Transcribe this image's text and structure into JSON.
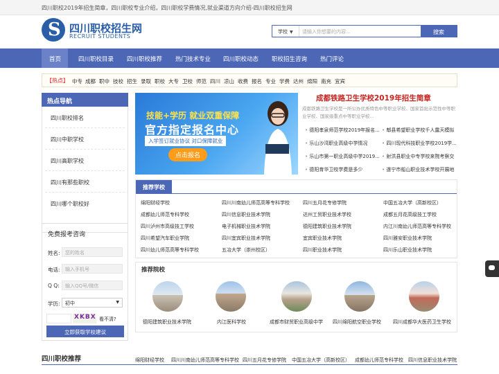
{
  "topbar": {
    "text": "四川职校2019年招生简章，四川职校专业介绍，四川职校学费情况,就业渠道方向介绍-四川职校招生网"
  },
  "logo": {
    "cn": "四川职校招生网",
    "en": "RECRUIT STUDENTS"
  },
  "search": {
    "select": "学校",
    "placeholder": "请输入你想要的内容...",
    "button": "搜索"
  },
  "nav": [
    "首页",
    "四川职校目录",
    "四川职校推荐",
    "热门技术专业",
    "四川职校动态",
    "职校招生咨询",
    "热门评论"
  ],
  "hot": {
    "tag": "【热点】",
    "keywords": [
      "中专",
      "成都",
      "职中",
      "技校",
      "招生",
      "录取",
      "职校",
      "大专",
      "卫校",
      "师范",
      "四川",
      "凉山",
      "收费",
      "报名",
      "专业",
      "学费",
      "达州",
      "绵阳",
      "南充",
      "宜宾"
    ]
  },
  "sidebar": {
    "title": "热点导航",
    "items": [
      "四川职校排名",
      "四川中职学校",
      "四川高职学校",
      "四川有那些职校",
      "四川哪个职校好"
    ]
  },
  "form": {
    "title": "免费报考咨询",
    "name_label": "姓名:",
    "name_ph": "您的姓名",
    "phone_label": "电话:",
    "phone_ph": "输入手机号",
    "qq_label": "Q Q:",
    "qq_ph": "输入QQ号/微信",
    "edu_label": "学历:",
    "edu_value": "初中",
    "captcha": "XKBX",
    "captcha_link": "看不清?",
    "submit": "立即获取学校建议"
  },
  "banner": {
    "line1": "技能+学历 就业双重保障",
    "line2": "官方指定报名中心",
    "line3": "入学签订就业协议 对口保障就业",
    "button": "点击报名"
  },
  "article": {
    "title": "成都铁路卫生学校2019年招生简章",
    "summary": "成都铁路卫生学校是一所公办优质特色中等职业学校、国家首批示范性中等职业学校、国家级重点中等职业学校...",
    "links": [
      "德阳孝泉师范学校2019年报名...",
      "郫县希望职业学校千人露天模拟",
      "乐山沙湾职业高级中学情况",
      "四川现代科技职业学校2019学...",
      "乐山市第一职业高级中学2019...",
      "射洪县职业中专学校来院考察交",
      "德阳育华卫校学费是多少",
      "遂宁市船山职业技术学校开展地"
    ]
  },
  "recommend": {
    "title": "推荐学校",
    "schools": [
      "绵阳财经学校",
      "四川川南幼儿师范高等专科学校",
      "四川五月花专修学院",
      "中国五冶大学（高新校区）",
      "成都幼儿师范专科学校",
      "四川信息职业技术学院",
      "达州工贸职业技术学校",
      "成都五月花高级技工学校",
      "四川泸州市高级技工学校",
      "电子机械职业技术学院",
      "德阳建筑职业技术学院",
      "内江川南幼儿师范高等专科学校",
      "四川希望汽车职业学院",
      "四川宜宾职业技术学院",
      "宜宾职业技术学院",
      "四川雅安职业技术学院",
      "四川幼儿师范高等专科学校",
      "五冶大学（崇州校区）",
      "四川职业技术学院",
      "四川乐山职业技术学院"
    ]
  },
  "colleges": {
    "title": "推荐院校",
    "items": [
      "德阳建筑职业技术学院",
      "内江医科学校",
      "成都市财贸职业高级中学",
      "四川绵阳航空职业学校",
      "四川成都华大医药卫生学校"
    ]
  },
  "bottom": {
    "title": "四川职校推荐",
    "links": [
      "绵阳财经学校",
      "四川川南幼儿师范高等专科学校",
      "四川五月花专修学院",
      "中国五冶大学（高新校区）",
      "成都幼儿师范专科学校",
      "四川信息职业技术学院"
    ]
  },
  "colors": {
    "primary": "#4c67b6",
    "accent": "#c8231e",
    "hot": "#d9232d"
  }
}
